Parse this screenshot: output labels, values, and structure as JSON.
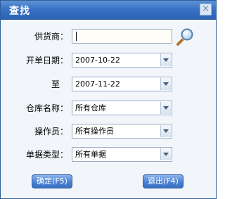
{
  "window": {
    "title": "查找",
    "close_symbol": "×"
  },
  "form": {
    "supplier": {
      "label": "供货商：",
      "value": ""
    },
    "start_date": {
      "label": "开单日期：",
      "value": "2007-10-22"
    },
    "end_date": {
      "label": "至",
      "value": "2007-11-22"
    },
    "warehouse": {
      "label": "仓库名称：",
      "value": "所有仓库"
    },
    "operator": {
      "label": "操作员：",
      "value": "所有操作员"
    },
    "doc_type": {
      "label": "单据类型：",
      "value": "所有单据"
    }
  },
  "buttons": {
    "ok": "确定(F5)",
    "exit": "退出(F4)"
  },
  "icons": {
    "search": "magnifier-icon",
    "dropdown": "chevron-down-icon",
    "close": "close-icon"
  },
  "colors": {
    "titlebar": "#3a73c4",
    "button": "#4b82d3",
    "background": "#f2f6fb"
  }
}
